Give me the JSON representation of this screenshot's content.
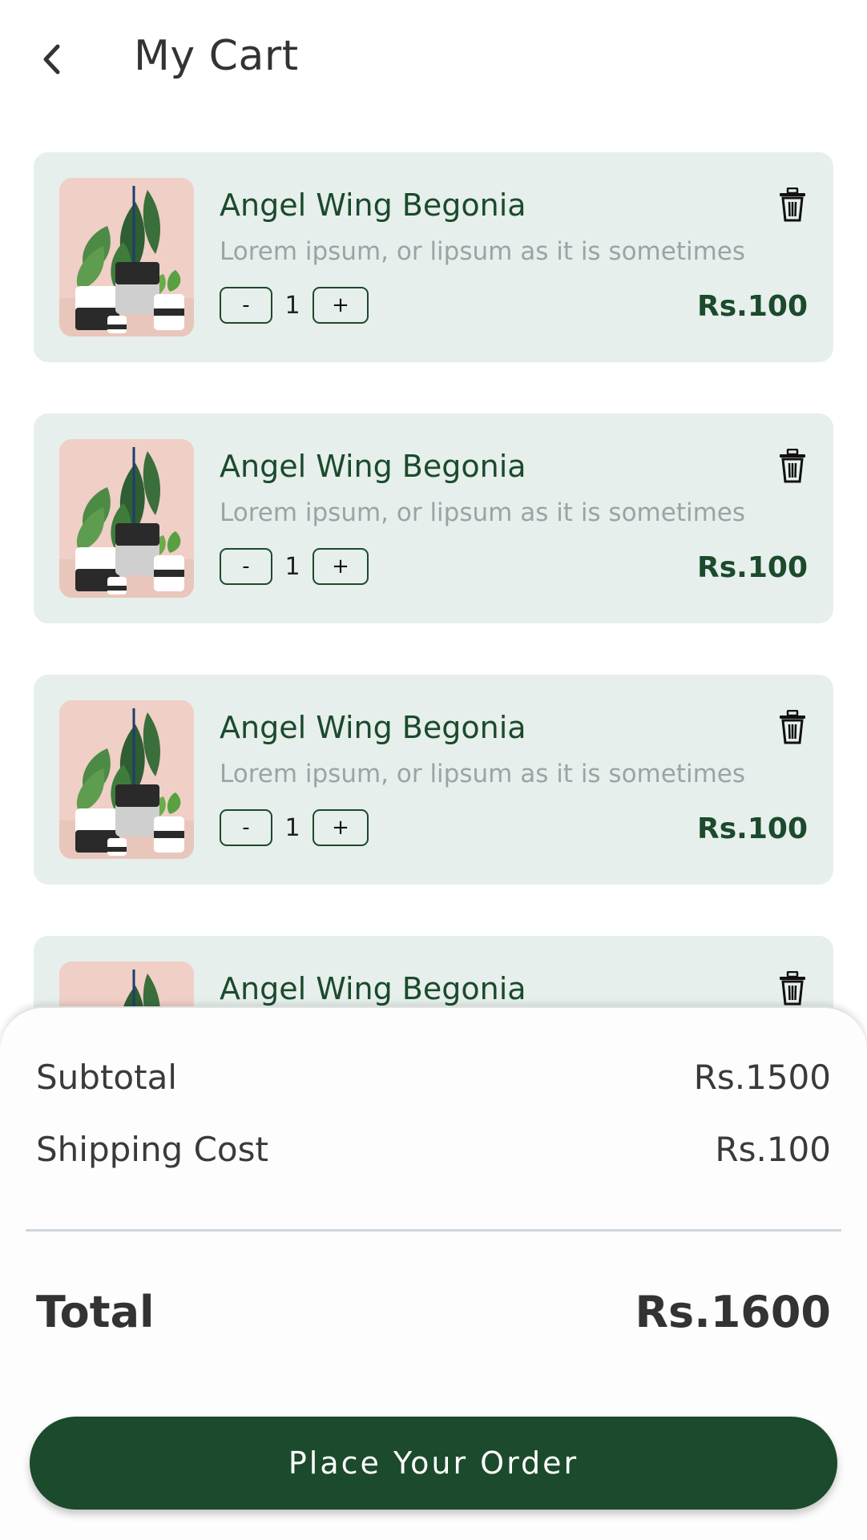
{
  "header": {
    "title": "My Cart",
    "back_icon": "chevron-left-icon"
  },
  "cart": {
    "items": [
      {
        "name": "Angel Wing Begonia",
        "description": "Lorem ipsum, or lipsum as it is sometimes",
        "quantity": "1",
        "minus": "-",
        "plus": "+",
        "price": "Rs.100"
      },
      {
        "name": "Angel Wing Begonia",
        "description": "Lorem ipsum, or lipsum as it is sometimes",
        "quantity": "1",
        "minus": "-",
        "plus": "+",
        "price": "Rs.100"
      },
      {
        "name": "Angel Wing Begonia",
        "description": "Lorem ipsum, or lipsum as it is sometimes",
        "quantity": "1",
        "minus": "-",
        "plus": "+",
        "price": "Rs.100"
      },
      {
        "name": "Angel Wing Begonia"
      }
    ]
  },
  "summary": {
    "subtotal_label": "Subtotal",
    "subtotal_value": "Rs.1500",
    "shipping_label": "Shipping Cost",
    "shipping_value": "Rs.100",
    "total_label": "Total",
    "total_value": "Rs.1600",
    "order_button": "Place Your Order"
  },
  "colors": {
    "brand_green": "#1b4a2c",
    "card_background": "#e6efeb",
    "description_gray": "#9aa3a7"
  }
}
